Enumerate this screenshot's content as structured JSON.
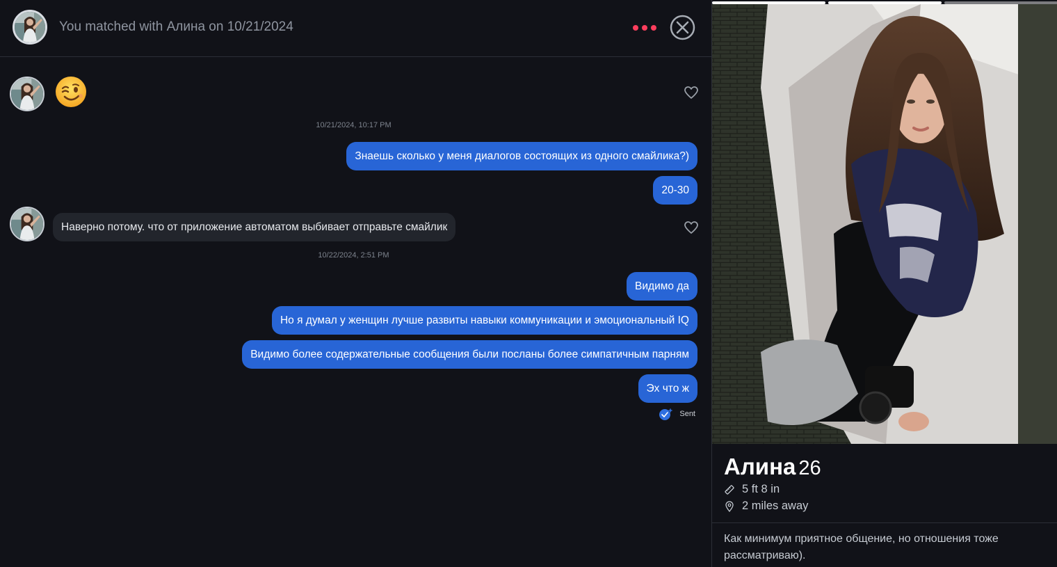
{
  "header": {
    "match_prefix": "You matched with",
    "match_name": "Алина",
    "match_on": "on",
    "match_date": "10/21/2024"
  },
  "messages": {
    "emoji": "😉",
    "timestamp_1": "10/21/2024, 10:17 PM",
    "out_1": "Знаешь сколько у меня диалогов состоящих из одного смайлика?)",
    "out_2": "20-30",
    "in_1": "Наверно потому. что от приложение автоматом выбивает отправьте смайлик",
    "timestamp_2": "10/22/2024, 2:51 PM",
    "out_3": "Видимо да",
    "out_4": "Но я думал у женщин лучше развиты навыки коммуникации и эмоциональный IQ",
    "out_5": "Видимо более содержательные сообщения были посланы более симпатичным парням",
    "out_6": "Эх что ж",
    "status": "Sent"
  },
  "profile": {
    "name": "Алина",
    "age": "26",
    "height": "5 ft 8 in",
    "distance": "2 miles away",
    "bio": "Как минимум приятное общение, но отношения тоже рассматриваю)."
  },
  "colors": {
    "accent": "#fd3e5d",
    "bubble_out": "#2865d6",
    "bubble_in": "#22252c",
    "background": "#111218"
  }
}
